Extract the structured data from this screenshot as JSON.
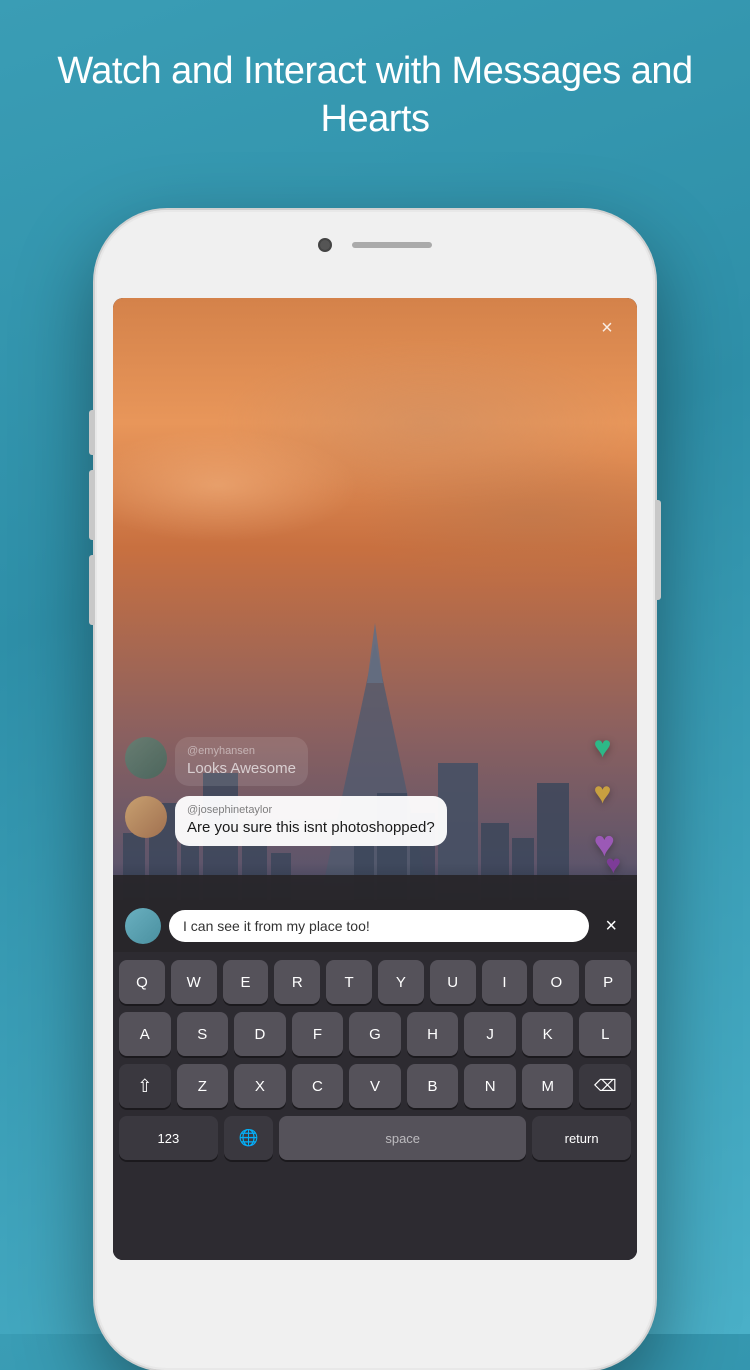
{
  "header": {
    "title": "Watch and Interact with Messages and Hearts"
  },
  "close_button": "×",
  "messages": [
    {
      "username": "@emyhansen",
      "text": "Looks Awesome",
      "style": "faded",
      "avatar_type": "teal"
    },
    {
      "username": "@josephinetaylor",
      "text": "Are you sure this isnt photoshopped?",
      "style": "white",
      "avatar_type": "face"
    }
  ],
  "input": {
    "text": "I can see it from my place too!",
    "close_label": "×"
  },
  "hearts": [
    {
      "color": "green",
      "char": "♥"
    },
    {
      "color": "gold",
      "char": "♥"
    },
    {
      "color": "purple",
      "char": "♥"
    },
    {
      "color": "purple-dark",
      "char": "♥"
    }
  ],
  "keyboard": {
    "row1": [
      "Q",
      "W",
      "E",
      "R",
      "T",
      "Y",
      "U",
      "I",
      "O",
      "P"
    ],
    "row2": [
      "A",
      "S",
      "D",
      "F",
      "G",
      "H",
      "J",
      "K",
      "L"
    ],
    "row3": [
      "Z",
      "X",
      "C",
      "V",
      "B",
      "N",
      "M"
    ],
    "shift_label": "⇧",
    "delete_label": "⌫",
    "space_label": " "
  }
}
